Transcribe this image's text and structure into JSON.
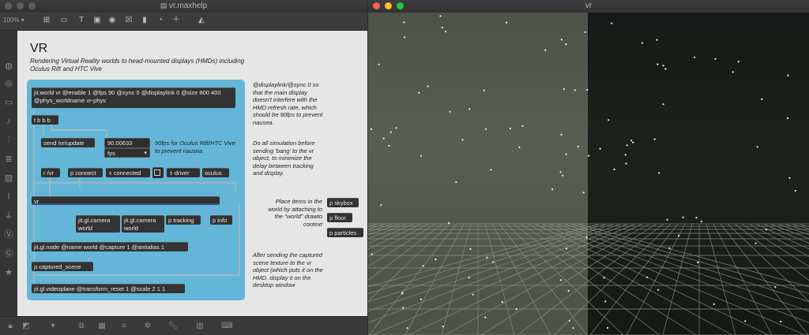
{
  "max_window": {
    "title": "vr.maxhelp",
    "zoom": "100%",
    "title_text": "VR",
    "subtitle": "Rendering Virtual Reality worlds to head-mounted displays (HMDs) including Oculus Rift and HTC Vive",
    "objects": {
      "jit_world": "jit.world vr @enable 1 @fps 90 @sync 0 @displaylink 0 @size 800 400 @phys_worldname vr-phys",
      "tbbb": "t b b b",
      "send_update": "send /vr/update",
      "fps_value": "90.00633",
      "fps_menu": "fps",
      "r_vr": "r /vr",
      "p_connect": "p connect",
      "connected": "connected",
      "driver": "driver",
      "oculus": "oculus",
      "vr": "vr",
      "cam1": "jit.gl.camera world",
      "cam2": "jit.gl.camera world",
      "p_tracking": "p tracking",
      "p_info": "p info",
      "gl_node": "jit.gl.node @name world @capture 1 @antialias 1",
      "p_captured": "p captured_scene",
      "videoplane": "jit.gl.videoplane @transform_reset 1 @scale 2 1 1",
      "p_skybox": "p skybox",
      "p_floor": "p floor",
      "p_particles": "p particles"
    },
    "comments": {
      "fps_note": "90fps for Oculus Rift/HTC Vive to prevent nausea",
      "displaylink_note": "@displaylink/@sync 0 so that the main display doesn't interfere with the HMD refresh rate, which should be 90fps to prevent nausea.",
      "simulation_note": "Do all simulation before sending 'bang' to the vr object, to minimize the delay between tracking and display.",
      "place_items": "Place items in the world by attaching to the \"world\" drawto context",
      "after_sending": "After sending the captured scene texture to the vr object (which puts it on the HMD, display it on the desktop window"
    }
  },
  "vr_window": {
    "title": "vr"
  },
  "colors": {
    "panel": "#63b6d8",
    "object_box": "#333333"
  }
}
